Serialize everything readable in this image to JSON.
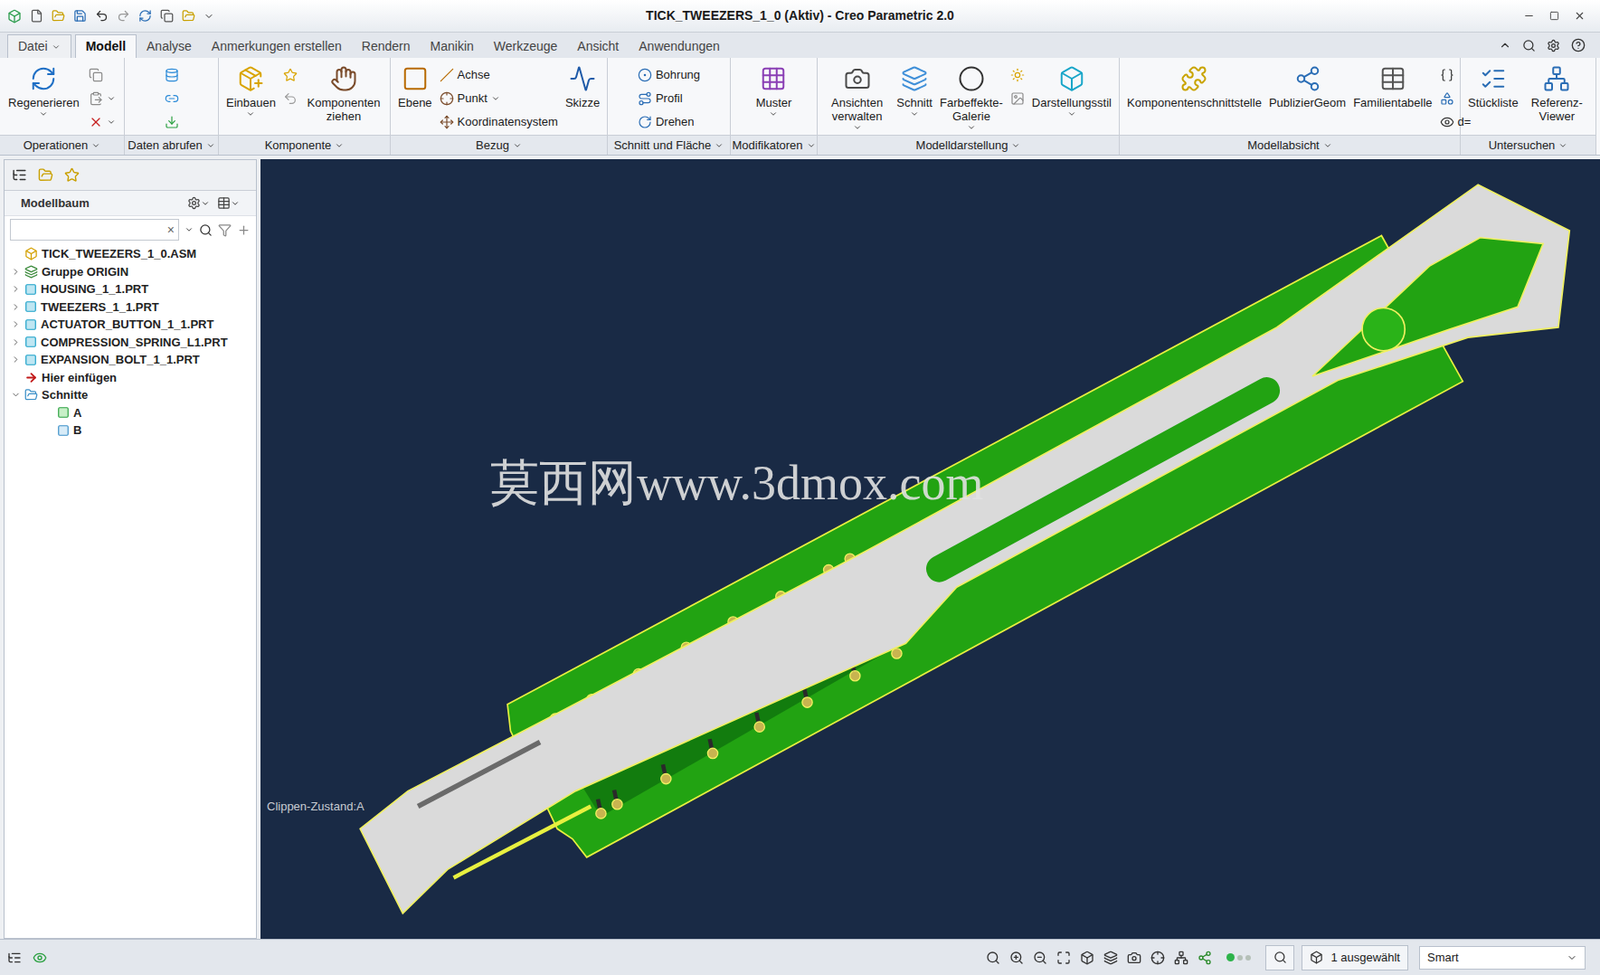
{
  "window": {
    "title": "TICK_TWEEZERS_1_0 (Aktiv) - Creo Parametric 2.0"
  },
  "tabs": [
    {
      "label": "Datei",
      "kind": "menu",
      "selected": false
    },
    {
      "label": "Modell",
      "kind": "tab",
      "selected": true
    },
    {
      "label": "Analyse",
      "kind": "tab",
      "selected": false
    },
    {
      "label": "Anmerkungen erstellen",
      "kind": "tab",
      "selected": false
    },
    {
      "label": "Rendern",
      "kind": "tab",
      "selected": false
    },
    {
      "label": "Manikin",
      "kind": "tab",
      "selected": false
    },
    {
      "label": "Werkzeuge",
      "kind": "tab",
      "selected": false
    },
    {
      "label": "Ansicht",
      "kind": "tab",
      "selected": false
    },
    {
      "label": "Anwendungen",
      "kind": "tab",
      "selected": false
    }
  ],
  "ribbon": [
    {
      "label": "Operationen",
      "columns": [
        {
          "kind": "large",
          "label": "Regenerieren",
          "dropdown": true
        },
        {
          "kind": "stack",
          "items": [
            {
              "label": "",
              "dropdown": false
            },
            {
              "label": "",
              "dropdown": true
            },
            {
              "label": "",
              "dropdown": true
            }
          ]
        }
      ]
    },
    {
      "label": "Daten abrufen",
      "columns": [
        {
          "kind": "stack",
          "items": [
            {
              "label": "",
              "dropdown": false
            },
            {
              "label": "",
              "dropdown": false
            },
            {
              "label": "",
              "dropdown": false
            }
          ]
        }
      ]
    },
    {
      "label": "Komponente",
      "columns": [
        {
          "kind": "large",
          "label": "Einbauen",
          "dropdown": true
        },
        {
          "kind": "stack",
          "items": [
            {
              "label": "",
              "dropdown": false
            },
            {
              "label": "",
              "dropdown": false
            }
          ]
        },
        {
          "kind": "large",
          "label": "Komponenten ziehen",
          "dropdown": false
        }
      ]
    },
    {
      "label": "Bezug",
      "columns": [
        {
          "kind": "large",
          "label": "Ebene",
          "dropdown": false
        },
        {
          "kind": "stack",
          "items": [
            {
              "label": "Achse",
              "dropdown": false
            },
            {
              "label": "Punkt",
              "dropdown": true
            },
            {
              "label": "Koordinatensystem",
              "dropdown": false
            }
          ]
        },
        {
          "kind": "large",
          "label": "Skizze",
          "dropdown": false
        }
      ]
    },
    {
      "label": "Schnitt und Fläche",
      "columns": [
        {
          "kind": "stack",
          "items": [
            {
              "label": "Bohrung",
              "dropdown": false
            },
            {
              "label": "Profil",
              "dropdown": false
            },
            {
              "label": "Drehen",
              "dropdown": false
            }
          ]
        }
      ]
    },
    {
      "label": "Modifikatoren",
      "columns": [
        {
          "kind": "large",
          "label": "Muster",
          "dropdown": true
        }
      ]
    },
    {
      "label": "Modelldarstellung",
      "columns": [
        {
          "kind": "large",
          "label": "Ansichten verwalten",
          "dropdown": true
        },
        {
          "kind": "large",
          "label": "Schnitt",
          "dropdown": true
        },
        {
          "kind": "large",
          "label": "Farbeffekte-Galerie",
          "dropdown": true
        },
        {
          "kind": "stack",
          "items": [
            {
              "label": "",
              "dropdown": false
            },
            {
              "label": "",
              "dropdown": false
            }
          ]
        },
        {
          "kind": "large",
          "label": "Darstellungsstil",
          "dropdown": true
        }
      ]
    },
    {
      "label": "Modellabsicht",
      "columns": [
        {
          "kind": "large",
          "label": "Komponentenschnittstelle",
          "dropdown": false
        },
        {
          "kind": "large",
          "label": "PublizierGeom",
          "dropdown": false
        },
        {
          "kind": "large",
          "label": "Familientabelle",
          "dropdown": false
        },
        {
          "kind": "stack",
          "items": [
            {
              "label": "",
              "dropdown": false
            },
            {
              "label": "",
              "dropdown": false
            },
            {
              "label": "d=",
              "dropdown": false
            }
          ]
        }
      ]
    },
    {
      "label": "Untersuchen",
      "columns": [
        {
          "kind": "large",
          "label": "Stückliste",
          "dropdown": false
        },
        {
          "kind": "large",
          "label": "Referenz-Viewer",
          "dropdown": false
        }
      ]
    }
  ],
  "model_tree": {
    "title": "Modellbaum",
    "search": {
      "value": "",
      "clear": "×"
    },
    "items": [
      {
        "label": "TICK_TWEEZERS_1_0.ASM",
        "kind": "asm",
        "level": 0,
        "expandable": false,
        "expanded": false,
        "selected": false
      },
      {
        "label": "Gruppe ORIGIN",
        "kind": "group",
        "level": 0,
        "expandable": true,
        "expanded": false,
        "selected": false
      },
      {
        "label": "HOUSING_1_1.PRT",
        "kind": "part",
        "level": 0,
        "expandable": true,
        "expanded": false,
        "selected": false
      },
      {
        "label": "TWEEZERS_1_1.PRT",
        "kind": "part",
        "level": 0,
        "expandable": true,
        "expanded": false,
        "selected": false
      },
      {
        "label": "ACTUATOR_BUTTON_1_1.PRT",
        "kind": "part",
        "level": 0,
        "expandable": true,
        "expanded": false,
        "selected": false
      },
      {
        "label": "COMPRESSION_SPRING_L1.PRT",
        "kind": "part",
        "level": 0,
        "expandable": true,
        "expanded": false,
        "selected": false
      },
      {
        "label": "EXPANSION_BOLT_1_1.PRT",
        "kind": "part",
        "level": 0,
        "expandable": true,
        "expanded": false,
        "selected": false
      },
      {
        "label": "Hier einfügen",
        "kind": "insert",
        "level": 0,
        "expandable": false,
        "expanded": false,
        "selected": false
      },
      {
        "label": "Schnitte",
        "kind": "folder",
        "level": 0,
        "expandable": true,
        "expanded": true,
        "selected": false
      },
      {
        "label": "A",
        "kind": "section-active",
        "level": 1,
        "expandable": false,
        "expanded": false,
        "selected": false
      },
      {
        "label": "B",
        "kind": "section",
        "level": 1,
        "expandable": false,
        "expanded": false,
        "selected": false
      }
    ]
  },
  "viewport": {
    "watermark": "莫西网www.3dmox.com",
    "clip_label": "Clippen-Zustand:A"
  },
  "status_bar": {
    "selection": "1 ausgewählt",
    "filter": "Smart"
  }
}
